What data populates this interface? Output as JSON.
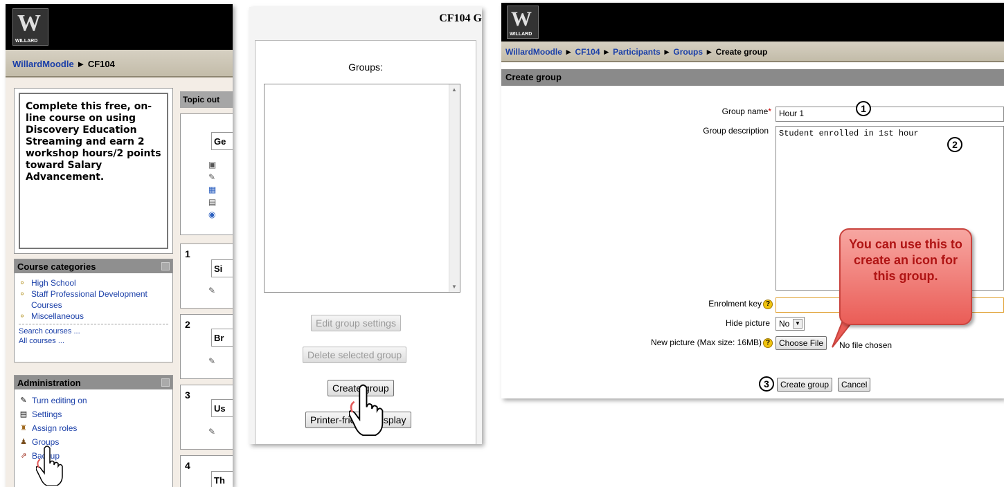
{
  "left": {
    "logo_text": "WILLARD",
    "breadcrumb": {
      "home": "WillardMoodle",
      "separator": "►",
      "course": "CF104"
    },
    "intro_text": "Complete this free, on-line course on using Discovery Education Streaming and earn 2 workshop hours/2 points toward Salary Advancement.",
    "topic_header": "Topic out",
    "topics": [
      {
        "num": "",
        "label": "Ge"
      },
      {
        "num": "1",
        "label": "Si"
      },
      {
        "num": "2",
        "label": "Br"
      },
      {
        "num": "3",
        "label": "Us"
      },
      {
        "num": "4",
        "label": "Th"
      }
    ],
    "categories": {
      "title": "Course categories",
      "items": [
        "High School",
        "Staff Professional Development Courses",
        "Miscellaneous"
      ],
      "search": "Search courses ...",
      "all": "All courses ..."
    },
    "admin": {
      "title": "Administration",
      "items": [
        "Turn editing on",
        "Settings",
        "Assign roles",
        "Groups",
        "Backup"
      ]
    }
  },
  "middle": {
    "title": "CF104 G",
    "groups_label": "Groups:",
    "buttons": {
      "edit": "Edit group settings",
      "delete": "Delete selected group",
      "create": "Create group",
      "printer": "Printer-friendly display"
    }
  },
  "right": {
    "logo_text": "WILLARD",
    "breadcrumb": [
      "WillardMoodle",
      "CF104",
      "Participants",
      "Groups",
      "Create group"
    ],
    "separator": "►",
    "header": "Create group",
    "labels": {
      "group_name": "Group name",
      "group_description": "Group description",
      "enrolment_key": "Enrolment key",
      "hide_picture": "Hide picture",
      "new_picture": "New picture (Max size: 16MB)"
    },
    "values": {
      "group_name": "Hour 1",
      "group_description": "Student enrolled in 1st hour",
      "enrolment_key": "",
      "hide_picture": "No",
      "file_status": "No file chosen"
    },
    "buttons": {
      "choose_file": "Choose File",
      "create": "Create group",
      "cancel": "Cancel"
    },
    "step_markers": [
      "1",
      "2",
      "3"
    ],
    "callout": "You can use this to create an icon for this group."
  },
  "colors": {
    "link": "#1a3fa8",
    "navbar": "#c9c2b0",
    "header_gray": "#8a8a8a",
    "callout_red": "#ea5d57",
    "callout_text": "#b01414"
  }
}
